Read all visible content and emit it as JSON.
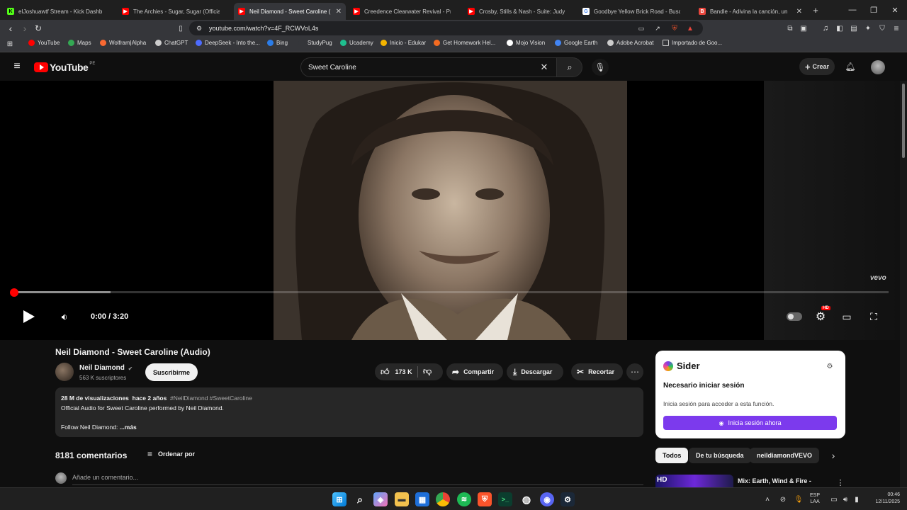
{
  "tabs": [
    {
      "title": "eIJoshuawtf Stream - Kick Dashb",
      "fav_color": "#53fc18",
      "fav_glyph": "K"
    },
    {
      "title": "The Archies - Sugar, Sugar (Official A",
      "fav_color": "#ff0000",
      "fav_glyph": "▶"
    },
    {
      "title": "Neil Diamond - Sweet Caroline (",
      "fav_color": "#ff0000",
      "fav_glyph": "▶"
    },
    {
      "title": "Creedence Clearwater Revival - Prou",
      "fav_color": "#ff0000",
      "fav_glyph": "▶"
    },
    {
      "title": "Crosby, Stills & Nash - Suite: Judy Bl",
      "fav_color": "#ff0000",
      "fav_glyph": "▶"
    },
    {
      "title": "Goodbye Yellow Brick Road - Buscar",
      "fav_color": "#ffffff",
      "fav_glyph": "G"
    },
    {
      "title": "Bandle - Adivina la canción, un",
      "fav_color": "#e8453c",
      "fav_glyph": "B"
    }
  ],
  "address": {
    "url": "youtube.com/watch?v=4F_RCWVoL4s"
  },
  "bookmarks": [
    {
      "label": "YouTube",
      "color": "#ff0000"
    },
    {
      "label": "Maps",
      "color": "#34a853"
    },
    {
      "label": "Wolfram|Alpha",
      "color": "#f96932"
    },
    {
      "label": "ChatGPT",
      "color": "#cccccc"
    },
    {
      "label": "DeepSeek - Into the...",
      "color": "#4d6bfe"
    },
    {
      "label": "Bing",
      "color": "#2b7de9"
    },
    {
      "label": "StudyPug",
      "color": "#35363a"
    },
    {
      "label": "Ucademy",
      "color": "#1fbf8f"
    },
    {
      "label": "Inicio - Edukar",
      "color": "#f4b400"
    },
    {
      "label": "Get Homework Hel...",
      "color": "#f36b21"
    },
    {
      "label": "Mojo Vision",
      "color": "#ffffff"
    },
    {
      "label": "Google Earth",
      "color": "#4285f4"
    },
    {
      "label": "Adobe Acrobat",
      "color": "#cccccc"
    },
    {
      "label": "Importado de Goo...",
      "color": "#35363a"
    }
  ],
  "youtube": {
    "logo_text": "YouTube",
    "region": "PE",
    "search_value": "Sweet Caroline",
    "create_label": "Crear",
    "notif_count": ""
  },
  "player": {
    "time": "0:00 / 3:20",
    "progress": 0.0,
    "buffered": 0.11,
    "watermark": "vevo",
    "quality_badge": "HD"
  },
  "video": {
    "title": "Neil Diamond - Sweet Caroline (Audio)",
    "channel": "Neil Diamond",
    "subscribers": "563 K suscriptores",
    "subscribe_label": "Suscribirme",
    "likes": "173 K",
    "share_label": "Compartir",
    "download_label": "Descargar",
    "clip_label": "Recortar"
  },
  "description": {
    "views": "28 M de visualizaciones",
    "age": "hace 2 años",
    "hashtags": "#NeilDiamond #SweetCaroline",
    "line1": "Official Audio for Sweet Caroline performed by Neil Diamond.",
    "line2": "Follow Neil Diamond:",
    "more": "...más"
  },
  "comments": {
    "count_label": "8181 comentarios",
    "sort_label": "Ordenar por",
    "add_placeholder": "Añade un comentario..."
  },
  "sider": {
    "brand": "Sider",
    "heading": "Necesario iniciar sesión",
    "body": "Inicia sesión para acceder a esta función.",
    "button": "Inicia sesión ahora",
    "accent": "#7c3aed"
  },
  "chips": [
    "Todos",
    "De tu búsqueda",
    "neildiamondVEVO"
  ],
  "recommendation": {
    "title": "Mix: Earth, Wind & Fire -",
    "badge": "HD"
  },
  "taskbar": {
    "lang1": "ESP",
    "lang2": "LAA",
    "time": "00:46",
    "date": "12/11/2025"
  }
}
